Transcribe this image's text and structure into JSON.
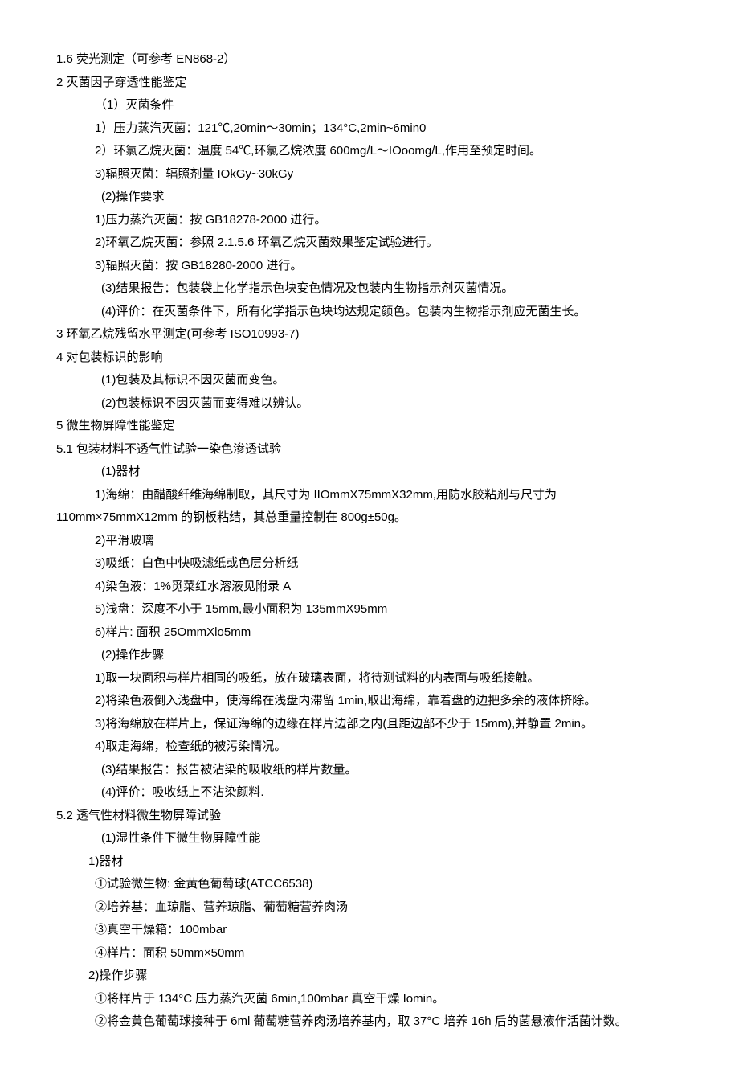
{
  "lines": [
    {
      "cls": "ind0",
      "text": "1.6 荧光测定（可参考 EN868-2）"
    },
    {
      "cls": "ind0",
      "text": "2 灭菌因子穿透性能鉴定"
    },
    {
      "cls": "ind1",
      "text": "（1）灭菌条件"
    },
    {
      "cls": "ind1",
      "text": "1）压力蒸汽灭菌：121℃,20min～30min；134°C,2min~6min0"
    },
    {
      "cls": "ind1",
      "text": "2）环氯乙烷灭菌：温度 54℃,环氯乙烷浓度 600mg/L～IOoomg/L,作用至预定时间。"
    },
    {
      "cls": "ind1",
      "text": "3)辐照灭菌：辐照剂量 IOkGy~30kGy"
    },
    {
      "cls": "ind2",
      "text": "(2)操作要求"
    },
    {
      "cls": "ind1",
      "text": "1)压力蒸汽灭菌：按 GB18278-2000 进行。"
    },
    {
      "cls": "ind1",
      "text": "2)环氧乙烷灭菌：参照 2.1.5.6 环氧乙烷灭菌效果鉴定试验进行。"
    },
    {
      "cls": "ind1",
      "text": "3)辐照灭菌：按 GB18280-2000 进行。"
    },
    {
      "cls": "ind2",
      "text": "(3)结果报告：包装袋上化学指示色块变色情况及包装内生物指示剂灭菌情况。"
    },
    {
      "cls": "ind2",
      "text": "(4)评价：在灭菌条件下，所有化学指示色块均达规定颜色。包装内生物指示剂应无菌生长。"
    },
    {
      "cls": "ind0",
      "text": "3 环氧乙烷残留水平测定(可参考 ISO10993-7)"
    },
    {
      "cls": "ind0",
      "text": "4 对包装标识的影响"
    },
    {
      "cls": "ind2",
      "text": "(1)包装及其标识不因灭菌而变色。"
    },
    {
      "cls": "ind2",
      "text": "(2)包装标识不因灭菌而变得难以辨认。"
    },
    {
      "cls": "ind0",
      "text": "5 微生物屏障性能鉴定"
    },
    {
      "cls": "ind0",
      "text": "5.1 包装材料不透气性试验一染色渗透试验"
    },
    {
      "cls": "ind2",
      "text": "(1)器材"
    },
    {
      "cls": "ind1",
      "text": "1)海绵：由醋酸纤维海绵制取，其尺寸为 IIOmmX75mmX32mm,用防水胶粘剂与尺寸为"
    },
    {
      "cls": "ind0",
      "text": "110mm×75mmX12mm 的钢板粘结，其总重量控制在 800g±50g。"
    },
    {
      "cls": "ind1",
      "text": "2)平滑玻璃"
    },
    {
      "cls": "ind1",
      "text": "3)吸纸：白色中快吸滤纸或色层分析纸"
    },
    {
      "cls": "ind1",
      "text": "4)染色液：1%觅菜红水溶液见附录 A"
    },
    {
      "cls": "ind1",
      "text": "5)浅盘：深度不小于 15mm,最小面积为 135mmX95mm"
    },
    {
      "cls": "ind1",
      "text": "6)样片: 面积 25OmmXlo5mm"
    },
    {
      "cls": "ind2",
      "text": "(2)操作步骤"
    },
    {
      "cls": "ind1",
      "text": "1)取一块面积与样片相同的吸纸，放在玻璃表面，将待测试料的内表面与吸纸接触。"
    },
    {
      "cls": "ind1",
      "text": "2)将染色液倒入浅盘中，使海绵在浅盘内滞留 1min,取出海绵，靠着盘的边把多余的液体挤除。"
    },
    {
      "cls": "ind1",
      "text": "3)将海绵放在样片上，保证海绵的边缘在样片边部之内(且距边部不少于 15mm),并静置 2min。"
    },
    {
      "cls": "ind1",
      "text": "4)取走海绵，检查纸的被污染情况。"
    },
    {
      "cls": "ind2",
      "text": "(3)结果报告：报告被沾染的吸收纸的样片数量。"
    },
    {
      "cls": "ind2",
      "text": "(4)评价：吸收纸上不沾染颜料."
    },
    {
      "cls": "ind0",
      "text": "5.2 透气性材料微生物屏障试验"
    },
    {
      "cls": "ind2",
      "text": "(1)湿性条件下微生物屏障性能"
    },
    {
      "cls": "ind3",
      "text": "1)器材"
    },
    {
      "cls": "ind1",
      "text": "①试验微生物: 金黄色葡萄球(ATCC6538)"
    },
    {
      "cls": "ind1",
      "text": "②培养基：血琼脂、营养琼脂、葡萄糖营养肉汤"
    },
    {
      "cls": "ind1",
      "text": "③真空干燥箱：100mbar"
    },
    {
      "cls": "ind1",
      "text": "④样片：面积 50mm×50mm"
    },
    {
      "cls": "ind3",
      "text": "2)操作步骤"
    },
    {
      "cls": "ind1",
      "text": "①将样片于 134°C 压力蒸汽灭菌 6min,100mbar 真空干燥 Iomin。"
    },
    {
      "cls": "ind1",
      "text": "②将金黄色葡萄球接种于 6ml 葡萄糖营养肉汤培养基内，取 37°C 培养 16h 后的菌悬液作活菌计数。"
    }
  ]
}
